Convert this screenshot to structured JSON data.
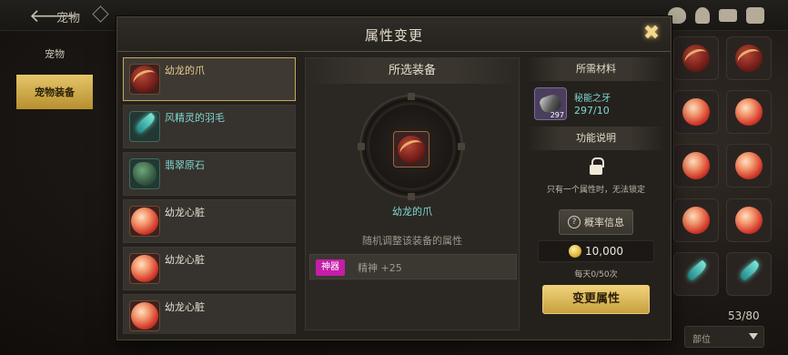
{
  "topbar": {
    "back_label": "宠物",
    "icons": [
      "back-arrow-icon",
      "diamond-icon",
      "pot-icon",
      "bell-icon",
      "mail-icon",
      "chat-icon"
    ]
  },
  "left_tabs": {
    "pet": "宠物",
    "pet_equipment": "宠物装备"
  },
  "inventory": {
    "count": "53/80",
    "filter": "部位"
  },
  "dialog": {
    "title": "属性变更",
    "items": [
      {
        "name": "幼龙的爪",
        "tag": "",
        "art": "claw"
      },
      {
        "name": "风精灵的羽毛",
        "tag": "",
        "art": "feather"
      },
      {
        "name": "翡翠原石",
        "tag": "",
        "art": "stone"
      },
      {
        "name": "幼龙心脏",
        "art": "orb"
      },
      {
        "name": "幼龙心脏",
        "art": "orb"
      },
      {
        "name": "幼龙心脏",
        "art": "orb"
      }
    ],
    "selected_section": "所选装备",
    "selected_item": "幼龙的爪",
    "description": "随机调整该装备的属性",
    "attribute": {
      "badge": "神器",
      "text": "精神 +25"
    },
    "materials_section": "所需材料",
    "material": {
      "name": "秘能之牙",
      "have": "297/10",
      "count": "297"
    },
    "function_section": "功能说明",
    "function_desc": "只有一个属性时，无法锁定",
    "probability_button": "概率信息",
    "gold": "10,000",
    "daily": "每天0/50次",
    "change_button": "变更属性",
    "colors": {
      "accent": "#c9a85a",
      "button": "#e0bc5c",
      "teal": "#7fd8d0",
      "badge": "#c41ea8"
    }
  }
}
